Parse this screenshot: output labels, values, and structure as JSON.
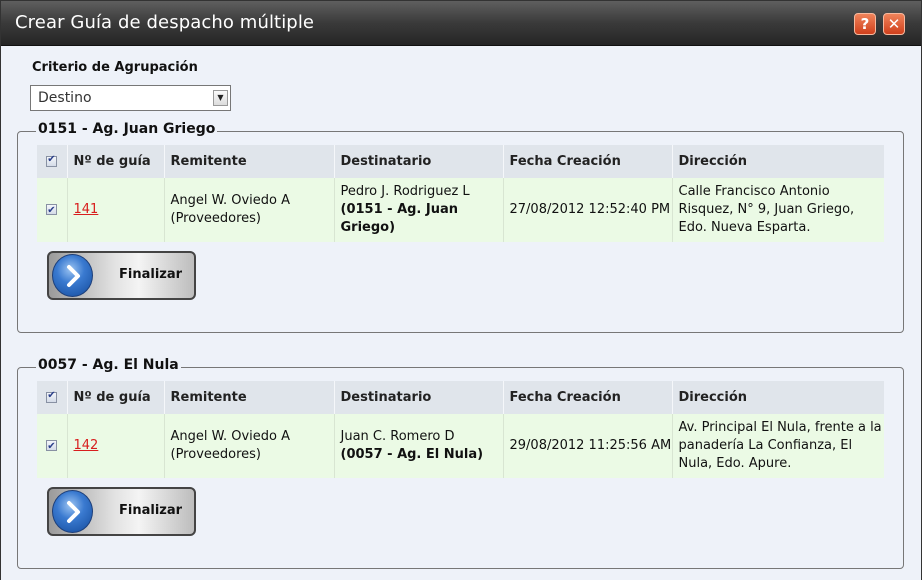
{
  "dialog": {
    "title": "Crear Guía de despacho múltiple",
    "help_glyph": "?",
    "close_glyph": "✕"
  },
  "criterio": {
    "label": "Criterio de Agrupación",
    "selected": "Destino"
  },
  "columns": [
    "Nº de guía",
    "Remitente",
    "Destinatario",
    "Fecha Creación",
    "Dirección"
  ],
  "groups": [
    {
      "legend": "0151 - Ag. Juan Griego",
      "rows": [
        {
          "checked": true,
          "guia": "141",
          "remitente_nombre": "Angel W. Oviedo A",
          "remitente_tipo": "(Proveedores)",
          "destinatario_nombre": "Pedro J. Rodriguez L",
          "destinatario_agencia": "(0151 - Ag. Juan Griego)",
          "fecha": "27/08/2012 12:52:40 PM",
          "direccion": "Calle Francisco Antonio Risquez, N° 9, Juan Griego, Edo. Nueva Esparta."
        }
      ],
      "button_label": "Finalizar"
    },
    {
      "legend": "0057 - Ag. El Nula",
      "rows": [
        {
          "checked": true,
          "guia": "142",
          "remitente_nombre": "Angel W. Oviedo A",
          "remitente_tipo": "(Proveedores)",
          "destinatario_nombre": "Juan C. Romero D",
          "destinatario_agencia": "(0057 - Ag. El Nula)",
          "fecha": "29/08/2012 11:25:56 AM",
          "direccion": "Av. Principal El Nula, frente a la panadería La Confianza, El Nula, Edo. Apure."
        }
      ],
      "button_label": "Finalizar"
    }
  ],
  "colors": {
    "titlebar": "#3a3a3a",
    "dialog_bg": "#eef2f9",
    "row_bg": "#ebfae5",
    "header_bg": "#e0e5eb",
    "link": "#d81e1e",
    "title_button": "#e0552e"
  }
}
